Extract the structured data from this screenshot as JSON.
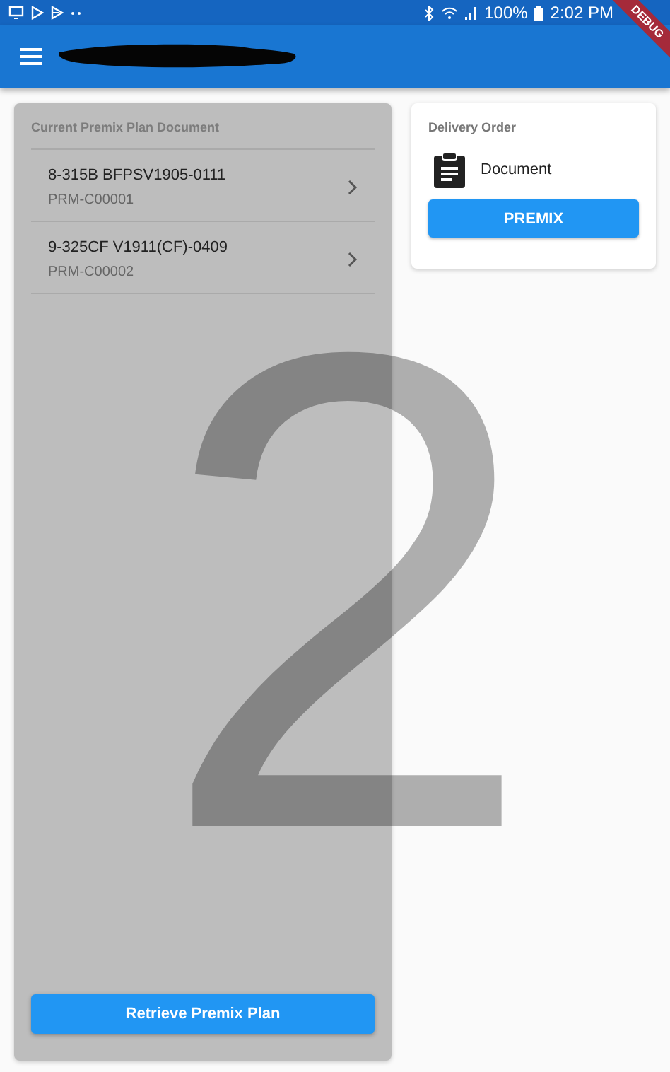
{
  "status_bar": {
    "battery": "100%",
    "time": "2:02 PM"
  },
  "debug_banner": "DEBUG",
  "page_number_overlay": "2",
  "plan_panel": {
    "title": "Current Premix Plan Document",
    "items": [
      {
        "title": "8-315B BFPSV1905-0111",
        "subtitle": "PRM-C00001"
      },
      {
        "title": "9-325CF V1911(CF)-0409",
        "subtitle": "PRM-C00002"
      }
    ],
    "button": "Retrieve Premix Plan"
  },
  "delivery_card": {
    "title": "Delivery Order",
    "document_label": "Document",
    "button": "PREMIX"
  }
}
